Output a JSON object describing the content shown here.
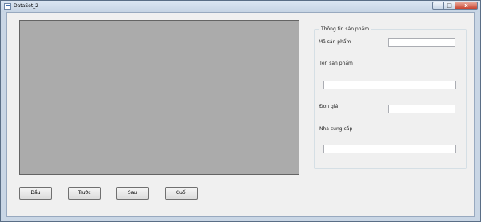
{
  "window": {
    "title": "DataSet_2",
    "min_glyph": "–",
    "max_glyph": "□",
    "close_glyph": "x"
  },
  "product_group": {
    "title": "Thông tin sản phẩm",
    "fields": {
      "product_code_label": "Mã sản phẩm",
      "product_code_value": "",
      "product_name_label": "Tên sản phẩm",
      "product_name_value": "",
      "unit_price_label": "Đơn giá",
      "unit_price_value": "",
      "supplier_label": "Nhà cung cấp",
      "supplier_value": ""
    }
  },
  "navigation": {
    "first_label": "Đầu",
    "prev_label": "Trước",
    "next_label": "Sau",
    "last_label": "Cuối"
  },
  "colors": {
    "grid_background": "#ababab",
    "form_background": "#f0f0f0",
    "close_button": "#c8432f"
  }
}
